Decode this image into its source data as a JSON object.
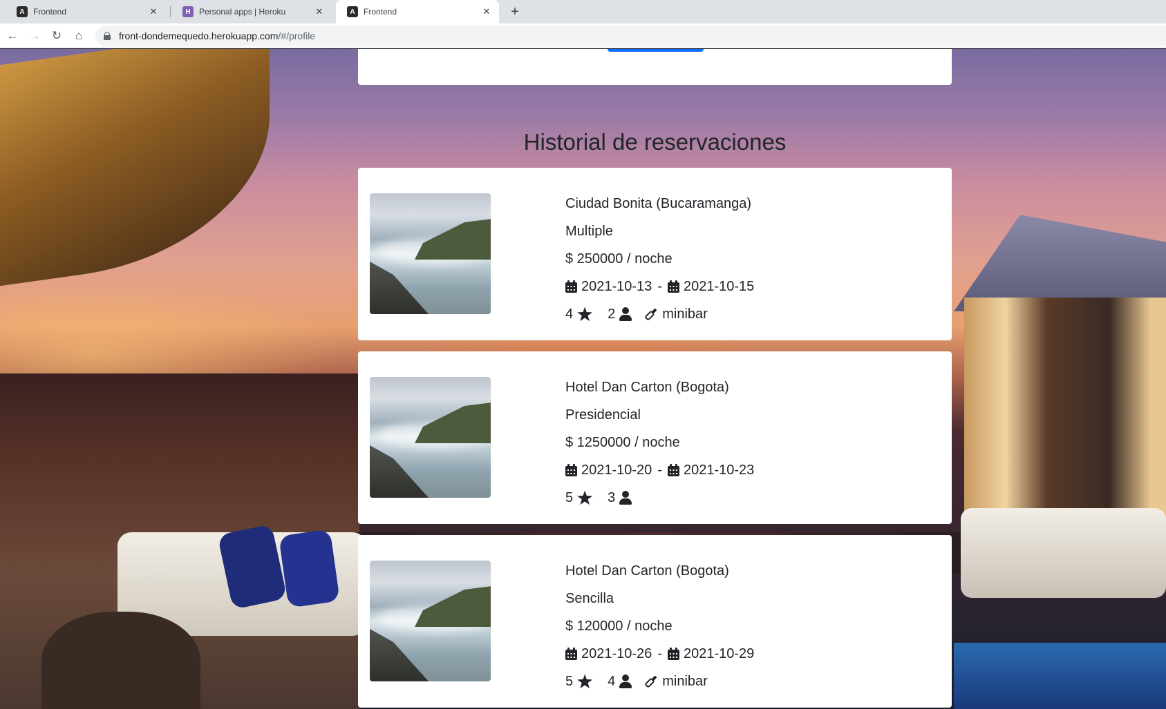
{
  "browser": {
    "tabs": [
      {
        "title": "Frontend",
        "favicon": "angular-icon",
        "active": false
      },
      {
        "title": "Personal apps | Heroku",
        "favicon": "heroku-icon",
        "active": false
      },
      {
        "title": "Frontend",
        "favicon": "angular-icon",
        "active": true
      }
    ],
    "new_tab_glyph": "+",
    "close_glyph": "✕",
    "url_host": "front-dondemequedo.herokuapp.com",
    "url_path": "/#/profile"
  },
  "page": {
    "section_title": "Historial de reservaciones",
    "reservations": [
      {
        "hotel": "Ciudad Bonita (Bucaramanga)",
        "room_type": "Multiple",
        "price": "$ 250000 / noche",
        "check_in": "2021-10-13",
        "check_out": "2021-10-15",
        "date_separator": "-",
        "stars": "4",
        "guests": "2",
        "amenity": "minibar"
      },
      {
        "hotel": "Hotel Dan Carton (Bogota)",
        "room_type": "Presidencial",
        "price": "$ 1250000 / noche",
        "check_in": "2021-10-20",
        "check_out": "2021-10-23",
        "date_separator": "-",
        "stars": "5",
        "guests": "3",
        "amenity": ""
      },
      {
        "hotel": "Hotel Dan Carton (Bogota)",
        "room_type": "Sencilla",
        "price": "$ 120000 / noche",
        "check_in": "2021-10-26",
        "check_out": "2021-10-29",
        "date_separator": "-",
        "stars": "5",
        "guests": "4",
        "amenity": "minibar"
      }
    ]
  },
  "colors": {
    "accent": "#0d6efd",
    "text": "#212529",
    "card_bg": "#ffffff"
  }
}
